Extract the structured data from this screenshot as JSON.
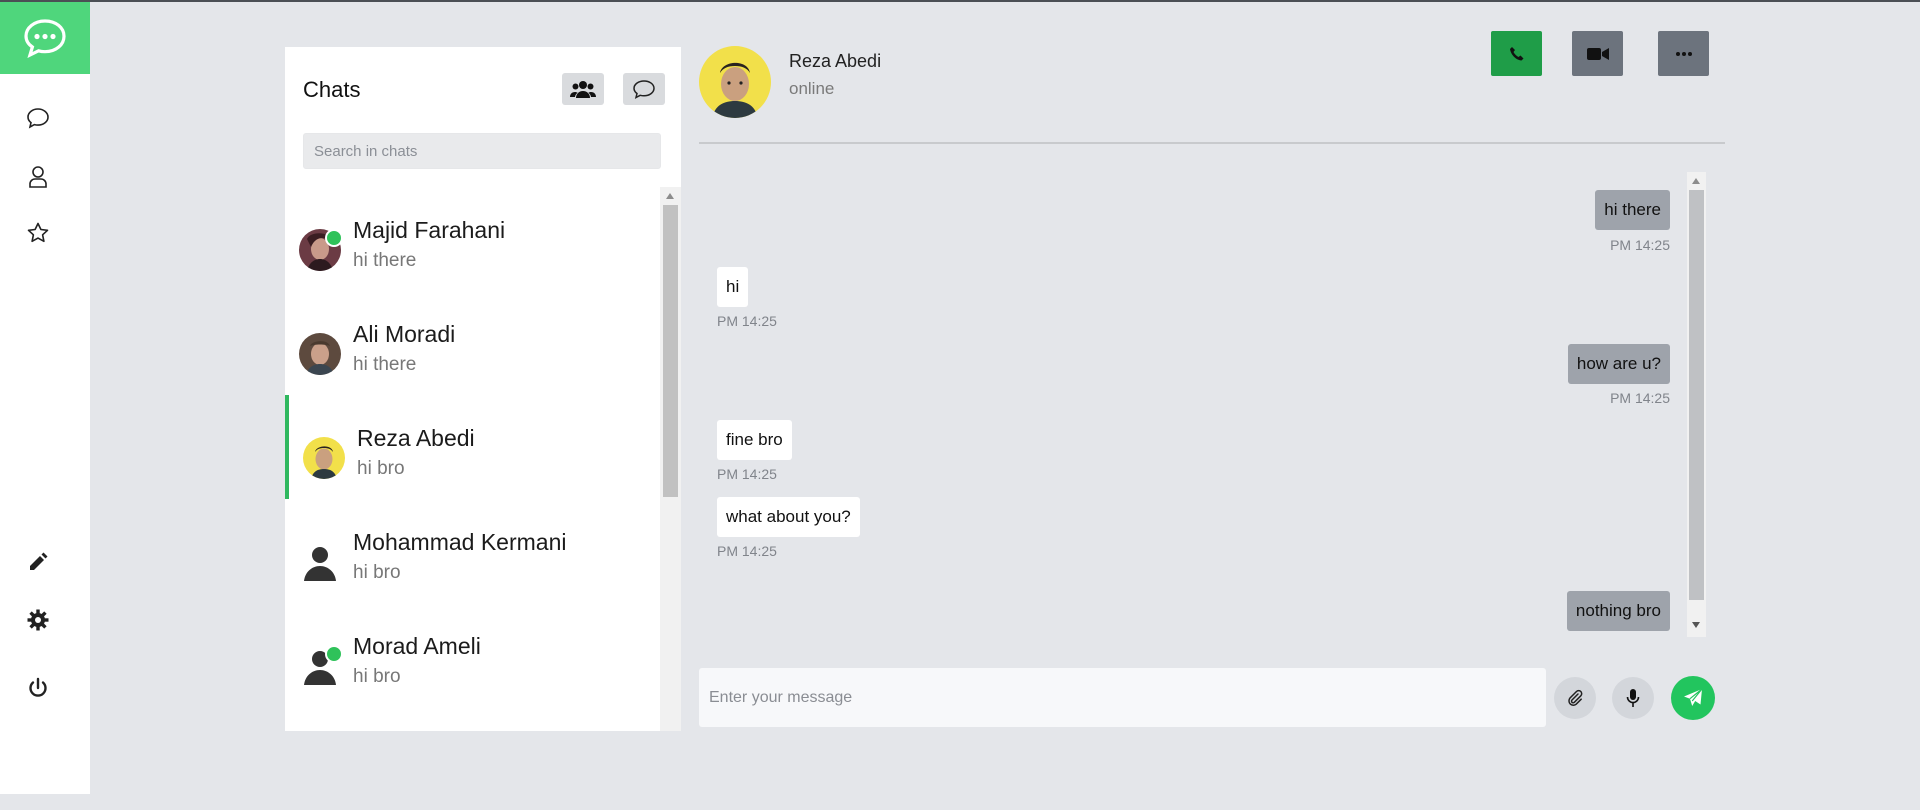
{
  "colors": {
    "accent": "#4fd67c",
    "call_button": "#1f9d48",
    "video_button": "#6c737d",
    "more_button": "#6c737d",
    "online": "#2fc25a",
    "send": "#22c55e"
  },
  "rail": {
    "icons": [
      "chat-logo-icon",
      "messages-icon",
      "contacts-icon",
      "favorites-icon",
      "edit-icon",
      "settings-icon",
      "power-icon"
    ]
  },
  "chats": {
    "title": "Chats",
    "search_placeholder": "Search in chats",
    "items": [
      {
        "name": "Majid Farahani",
        "preview": "hi there",
        "online": true
      },
      {
        "name": "Ali Moradi",
        "preview": "hi there",
        "online": false
      },
      {
        "name": "Reza Abedi",
        "preview": "hi bro",
        "online": false,
        "active": true
      },
      {
        "name": "Mohammad Kermani",
        "preview": "hi bro",
        "online": false
      },
      {
        "name": "Morad Ameli",
        "preview": "hi bro",
        "online": true
      }
    ]
  },
  "conversation": {
    "name": "Reza Abedi",
    "status": "online",
    "messages": [
      {
        "text": "hi there",
        "time": "PM 14:25",
        "direction": "out"
      },
      {
        "text": "hi",
        "time": "PM 14:25",
        "direction": "in"
      },
      {
        "text": "how are u?",
        "time": "PM 14:25",
        "direction": "out"
      },
      {
        "text": "fine bro",
        "time": "PM 14:25",
        "direction": "in"
      },
      {
        "text": "what about you?",
        "time": "PM 14:25",
        "direction": "in"
      },
      {
        "text": "nothing bro",
        "direction": "out"
      }
    ]
  },
  "composer": {
    "placeholder": "Enter your message"
  }
}
